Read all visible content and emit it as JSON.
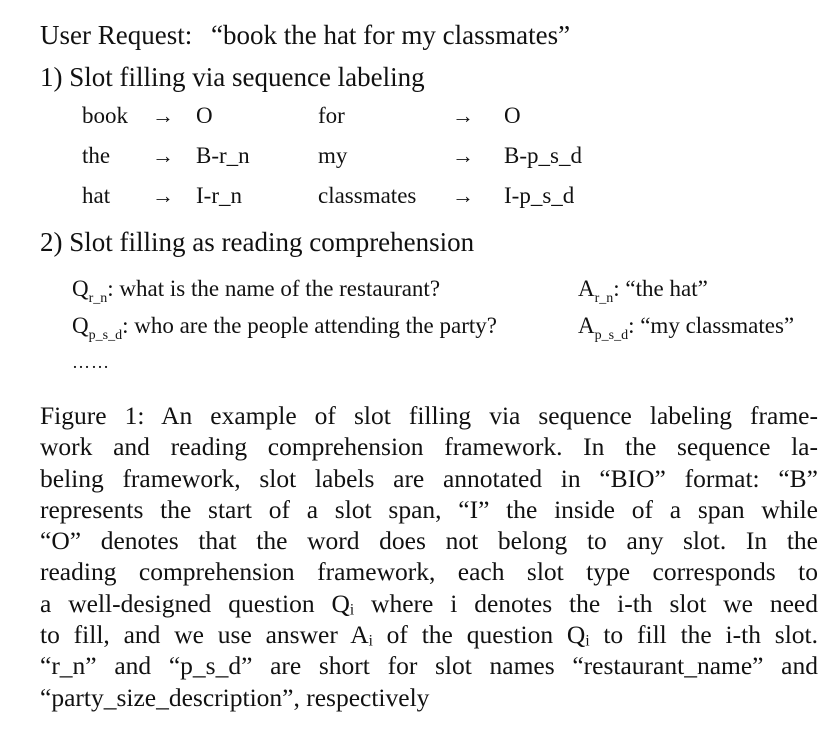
{
  "request": {
    "label": "User Request:",
    "text": "“book the hat for my classmates”"
  },
  "section1": {
    "title": "1) Slot filling via sequence labeling",
    "arrow": "→",
    "pairs": [
      {
        "word": "book",
        "tag": "O"
      },
      {
        "word": "the",
        "tag": "B-r_n"
      },
      {
        "word": "hat",
        "tag": "I-r_n"
      },
      {
        "word": "for",
        "tag": "O"
      },
      {
        "word": "my",
        "tag": "B-p_s_d"
      },
      {
        "word": "classmates",
        "tag": "I-p_s_d"
      }
    ]
  },
  "section2": {
    "title": "2) Slot filling as reading comprehension",
    "items": [
      {
        "q_base": "Q",
        "q_sub": "r_n",
        "question": ": what is the name of the restaurant?",
        "a_base": "A",
        "a_sub": "r_n",
        "answer": ": “the hat”"
      },
      {
        "q_base": "Q",
        "q_sub": "p_s_d",
        "question": ": who are the people attending the party?",
        "a_base": "A",
        "a_sub": "p_s_d",
        "answer": ": “my classmates”"
      }
    ],
    "ellipsis": "……"
  },
  "caption": {
    "lines": [
      "Figure 1: An example of slot filling via sequence labeling frame-",
      "work and reading comprehension framework. In the sequence la-",
      "beling framework, slot labels are annotated in “BIO” format: “B”",
      "represents the start of a slot span, “I” the inside of a span while",
      "“O” denotes that the word does not belong to any slot. In the",
      "reading comprehension framework, each slot type corresponds to",
      "a well-designed question Qᵢ where i denotes the i-th slot we need",
      "to fill, and we use answer Aᵢ of the question Qᵢ to fill the i-th slot.",
      "“r_n” and “p_s_d” are short for slot names “restaurant_name” and",
      "“party_size_description”, respectively"
    ]
  }
}
